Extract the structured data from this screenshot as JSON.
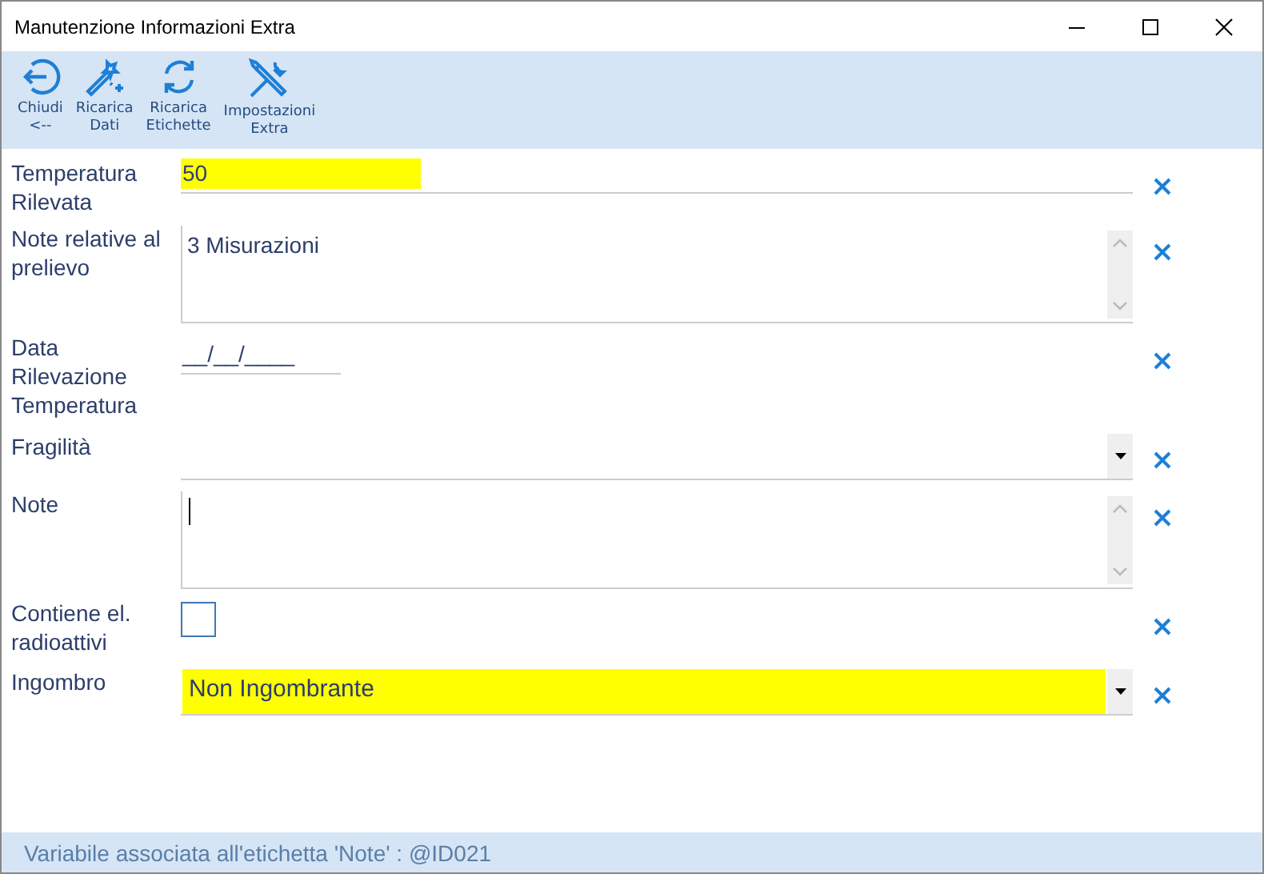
{
  "window": {
    "title": "Manutenzione Informazioni Extra"
  },
  "toolbar": [
    {
      "kind": "back",
      "label": "Chiudi\n<--"
    },
    {
      "kind": "wand",
      "label": "Ricarica\nDati"
    },
    {
      "kind": "refresh",
      "label": "Ricarica\nEtichette"
    },
    {
      "kind": "tools",
      "label": "Impostazioni\nExtra"
    }
  ],
  "fields": [
    {
      "kind": "text",
      "label": "Temperatura Rilevata",
      "value": "50",
      "highlighted": true
    },
    {
      "kind": "memo",
      "label": "Note relative al prelievo",
      "value": "3 Misurazioni",
      "focused": false
    },
    {
      "kind": "text",
      "label": "Data Rilevazione Temperatura",
      "value": "__/__/____",
      "highlighted": false
    },
    {
      "kind": "combo",
      "label": "Fragilità",
      "highlighted": false
    },
    {
      "kind": "memo",
      "label": "Note",
      "focused": true
    },
    {
      "kind": "checkbox",
      "label": "Contiene el. radioattivi",
      "checked": false
    },
    {
      "kind": "combo",
      "label": "Ingombro",
      "value": "Non Ingombrante",
      "highlighted": true
    }
  ],
  "status_bar": "Variabile associata all'etichetta 'Note' : @ID021"
}
